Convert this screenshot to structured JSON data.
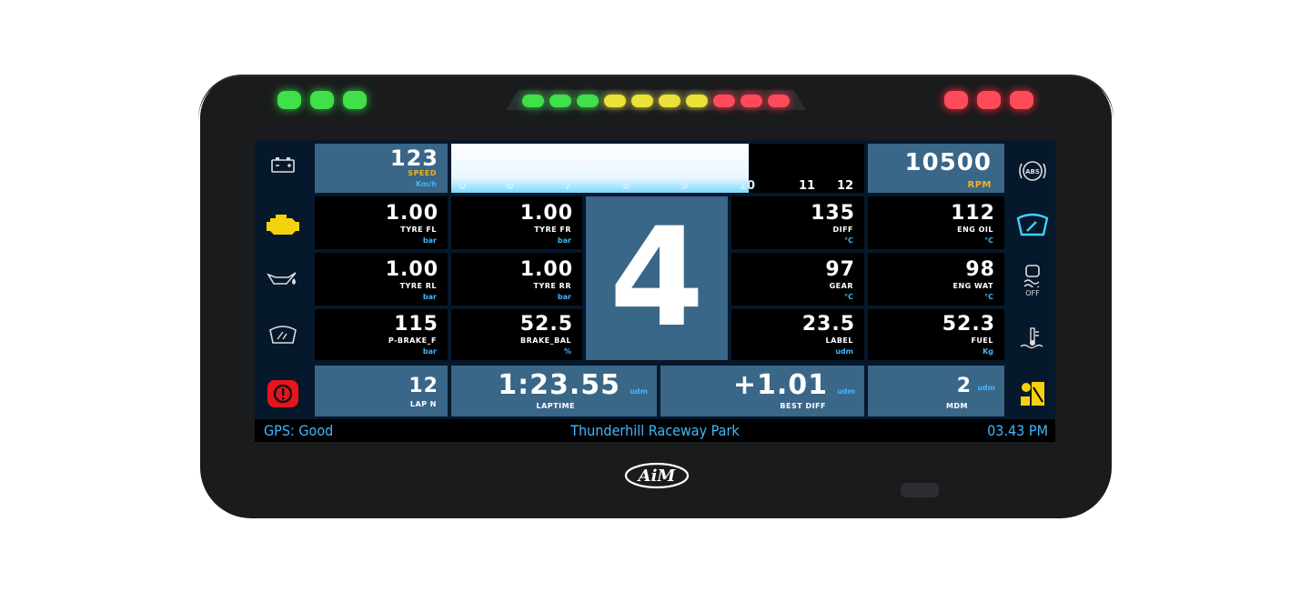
{
  "shift_lights": {
    "left": [
      "green",
      "green",
      "green"
    ],
    "center": [
      "green",
      "green",
      "green",
      "yellow",
      "yellow",
      "yellow",
      "yellow",
      "red",
      "red",
      "red"
    ],
    "right": [
      "red",
      "red",
      "red"
    ],
    "colors": {
      "green": "#3fe04a",
      "yellow": "#e8e23a",
      "red": "#ff4a5a"
    }
  },
  "left_icons": [
    "battery-icon",
    "engine-check-icon",
    "oil-pressure-icon",
    "washer-fluid-icon",
    "brake-warning-icon"
  ],
  "right_icons": [
    "abs-icon",
    "wiper-icon",
    "traction-control-off-icon",
    "coolant-temp-icon",
    "seat-belt-icon"
  ],
  "right_icon_labels": {
    "abs": "ABS",
    "tc": "OFF"
  },
  "speed": {
    "value": "123",
    "label": "SPEED",
    "unit": "Km/h"
  },
  "rpm_bar": {
    "ticks": [
      "0",
      "6",
      "7",
      "8",
      "9",
      "10",
      "11",
      "12"
    ],
    "fill_fraction": 0.72
  },
  "rpm": {
    "value": "10500",
    "label": "RPM"
  },
  "gear": "4",
  "tiles": {
    "tyre_fl": {
      "value": "1.00",
      "label": "TYRE FL",
      "unit": "bar"
    },
    "tyre_fr": {
      "value": "1.00",
      "label": "TYRE FR",
      "unit": "bar"
    },
    "tyre_rl": {
      "value": "1.00",
      "label": "TYRE RL",
      "unit": "bar"
    },
    "tyre_rr": {
      "value": "1.00",
      "label": "TYRE RR",
      "unit": "bar"
    },
    "p_brake": {
      "value": "115",
      "label": "P-BRAKE_F",
      "unit": "bar"
    },
    "brake_bal": {
      "value": "52.5",
      "label": "BRAKE_BAL",
      "unit": "%"
    },
    "diff": {
      "value": "135",
      "label": "DIFF",
      "unit": "°C"
    },
    "eng_oil": {
      "value": "112",
      "label": "ENG OIL",
      "unit": "°C"
    },
    "gear_temp": {
      "value": "97",
      "label": "GEAR",
      "unit": "°C"
    },
    "eng_wat": {
      "value": "98",
      "label": "ENG WAT",
      "unit": "°C"
    },
    "label_tile": {
      "value": "23.5",
      "label": "LABEL",
      "unit": "udm"
    },
    "fuel": {
      "value": "52.3",
      "label": "FUEL",
      "unit": "Kg"
    }
  },
  "bottom": {
    "lap_n": {
      "value": "12",
      "label": "LAP N"
    },
    "laptime": {
      "value": "1:23.55",
      "label": "LAPTIME",
      "unit": "udm"
    },
    "best_diff": {
      "value": "+1.01",
      "label": "BEST DIFF",
      "unit": "udm"
    },
    "mdm": {
      "value": "2",
      "label": "MDM",
      "unit": "udm"
    }
  },
  "status_bar": {
    "gps": "GPS: Good",
    "track": "Thunderhill Raceway Park",
    "time": "03.43 PM"
  },
  "brand": "AiM"
}
